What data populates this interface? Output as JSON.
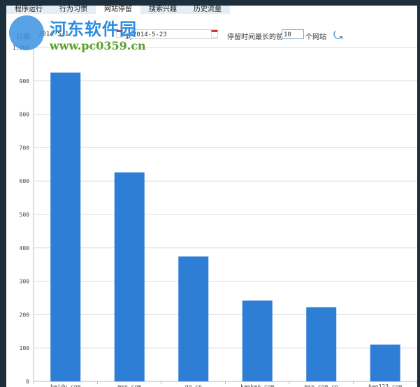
{
  "tabs": [
    {
      "label": "程序运行"
    },
    {
      "label": "行为习惯"
    },
    {
      "label": "网站停留",
      "active": true
    },
    {
      "label": "搜索兴趣"
    },
    {
      "label": "历史流量"
    }
  ],
  "toolbar": {
    "date_label": "日期：",
    "start_date": "2014-5-1",
    "to_label": "到",
    "end_date": "2014-5-23",
    "top_label": "停留时间最长的前",
    "top_n": "10",
    "top_suffix": "个网站",
    "refresh_icon": "refresh-arrow-icon"
  },
  "watermark": {
    "name": "河东软件园",
    "url": "www.pc0359.cn"
  },
  "colors": {
    "bar": "#2e7ed6",
    "grid": "#dddddd"
  },
  "chart_data": {
    "type": "bar",
    "categories": [
      "baidu.com",
      "msn.com",
      "qq.cn",
      "kankan.com",
      "msn.com.cn",
      "hao123.com"
    ],
    "values": [
      925,
      626,
      374,
      242,
      222,
      110
    ],
    "yticks": [
      "0",
      "100",
      "200",
      "300",
      "400",
      "500",
      "600",
      "700",
      "800",
      "900",
      "1,000"
    ],
    "ylim": [
      0,
      1000
    ],
    "title": "",
    "xlabel": "",
    "ylabel": ""
  }
}
